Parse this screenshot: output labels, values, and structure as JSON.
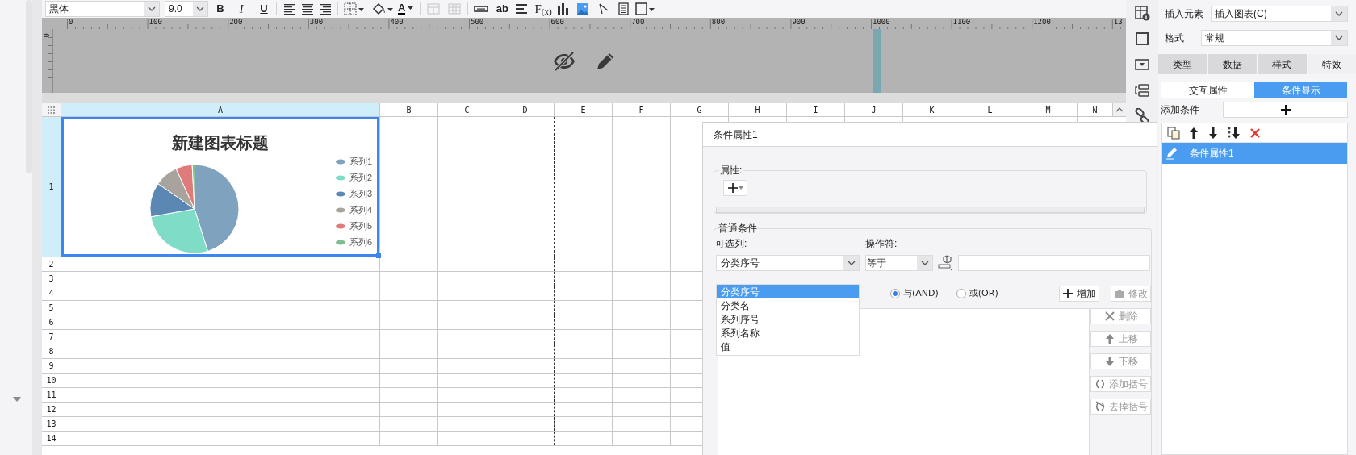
{
  "toolbar": {
    "font": "黑体",
    "font_size": "9.0",
    "bold": "B",
    "italic": "I",
    "underline": "U",
    "font_color": "A",
    "text_tool": "ab",
    "formula": "F$_{(x)}$"
  },
  "ruler": {
    "marks": [
      "0",
      "100",
      "200",
      "300",
      "400",
      "500",
      "600",
      "700",
      "800",
      "900",
      "1000",
      "1100",
      "1200",
      "13"
    ],
    "vertical_mark": "0"
  },
  "sheet": {
    "columns": [
      {
        "label": "A",
        "selected": true
      },
      {
        "label": "B",
        "selected": false
      },
      {
        "label": "C",
        "selected": false
      },
      {
        "label": "D",
        "selected": false
      },
      {
        "label": "E",
        "selected": false
      },
      {
        "label": "F",
        "selected": false
      },
      {
        "label": "G",
        "selected": false
      },
      {
        "label": "H",
        "selected": false
      },
      {
        "label": "I",
        "selected": false
      },
      {
        "label": "J",
        "selected": false
      },
      {
        "label": "K",
        "selected": false
      },
      {
        "label": "L",
        "selected": false
      },
      {
        "label": "M",
        "selected": false
      },
      {
        "label": "N",
        "selected": false
      }
    ],
    "rows": [
      {
        "label": "1",
        "selected": true
      },
      {
        "label": "2",
        "selected": false
      },
      {
        "label": "3",
        "selected": false
      },
      {
        "label": "4",
        "selected": false
      },
      {
        "label": "5",
        "selected": false
      },
      {
        "label": "6",
        "selected": false
      },
      {
        "label": "7",
        "selected": false
      },
      {
        "label": "8",
        "selected": false
      },
      {
        "label": "9",
        "selected": false
      },
      {
        "label": "10",
        "selected": false
      },
      {
        "label": "11",
        "selected": false
      },
      {
        "label": "12",
        "selected": false
      },
      {
        "label": "13",
        "selected": false
      },
      {
        "label": "14",
        "selected": false
      }
    ]
  },
  "chart": {
    "title": "新建图表标题",
    "legend": [
      {
        "label": "系列1",
        "color": "#7fa3bf"
      },
      {
        "label": "系列2",
        "color": "#7fdcc6"
      },
      {
        "label": "系列3",
        "color": "#5b87b3"
      },
      {
        "label": "系列4",
        "color": "#a8a39c"
      },
      {
        "label": "系列5",
        "color": "#e07b7b"
      },
      {
        "label": "系列6",
        "color": "#7fbf8f"
      }
    ]
  },
  "dialog": {
    "title": "条件属性1",
    "properties_label": "属性:",
    "common_label": "普通条件",
    "column_label": "可选列:",
    "column_value": "分类序号",
    "operator_label": "操作符:",
    "operator_value": "等于",
    "column_options": [
      {
        "label": "分类序号",
        "selected": true
      },
      {
        "label": "分类名",
        "selected": false
      },
      {
        "label": "系列序号",
        "selected": false
      },
      {
        "label": "系列名称",
        "selected": false
      },
      {
        "label": "值",
        "selected": false
      }
    ],
    "logic": [
      {
        "label": "与(AND)",
        "selected": true
      },
      {
        "label": "或(OR)",
        "selected": false
      }
    ],
    "buttons": [
      {
        "kind": "add",
        "label": "增加",
        "disabled": false
      },
      {
        "kind": "edit",
        "label": "修改",
        "disabled": true
      }
    ],
    "side_buttons": [
      {
        "kind": "delete",
        "label": "删除",
        "disabled": true
      },
      {
        "kind": "up",
        "label": "上移",
        "disabled": true
      },
      {
        "kind": "down",
        "label": "下移",
        "disabled": true
      },
      {
        "kind": "add-paren",
        "label": "添加括号",
        "disabled": true
      },
      {
        "kind": "remove-paren",
        "label": "去掉括号",
        "disabled": true
      }
    ]
  },
  "right_panel": {
    "insert_label": "插入元素",
    "insert_value": "插入图表(C)",
    "format_label": "格式",
    "format_value": "常规",
    "tabs": [
      {
        "label": "类型",
        "selected": false
      },
      {
        "label": "数据",
        "selected": false
      },
      {
        "label": "样式",
        "selected": false
      },
      {
        "label": "特效",
        "selected": true
      }
    ],
    "subtabs": [
      {
        "label": "交互属性",
        "selected": false
      },
      {
        "label": "条件显示",
        "selected": true
      }
    ],
    "add_condition_label": "添加条件",
    "conditions": [
      {
        "label": "条件属性1",
        "selected": true
      }
    ]
  }
}
